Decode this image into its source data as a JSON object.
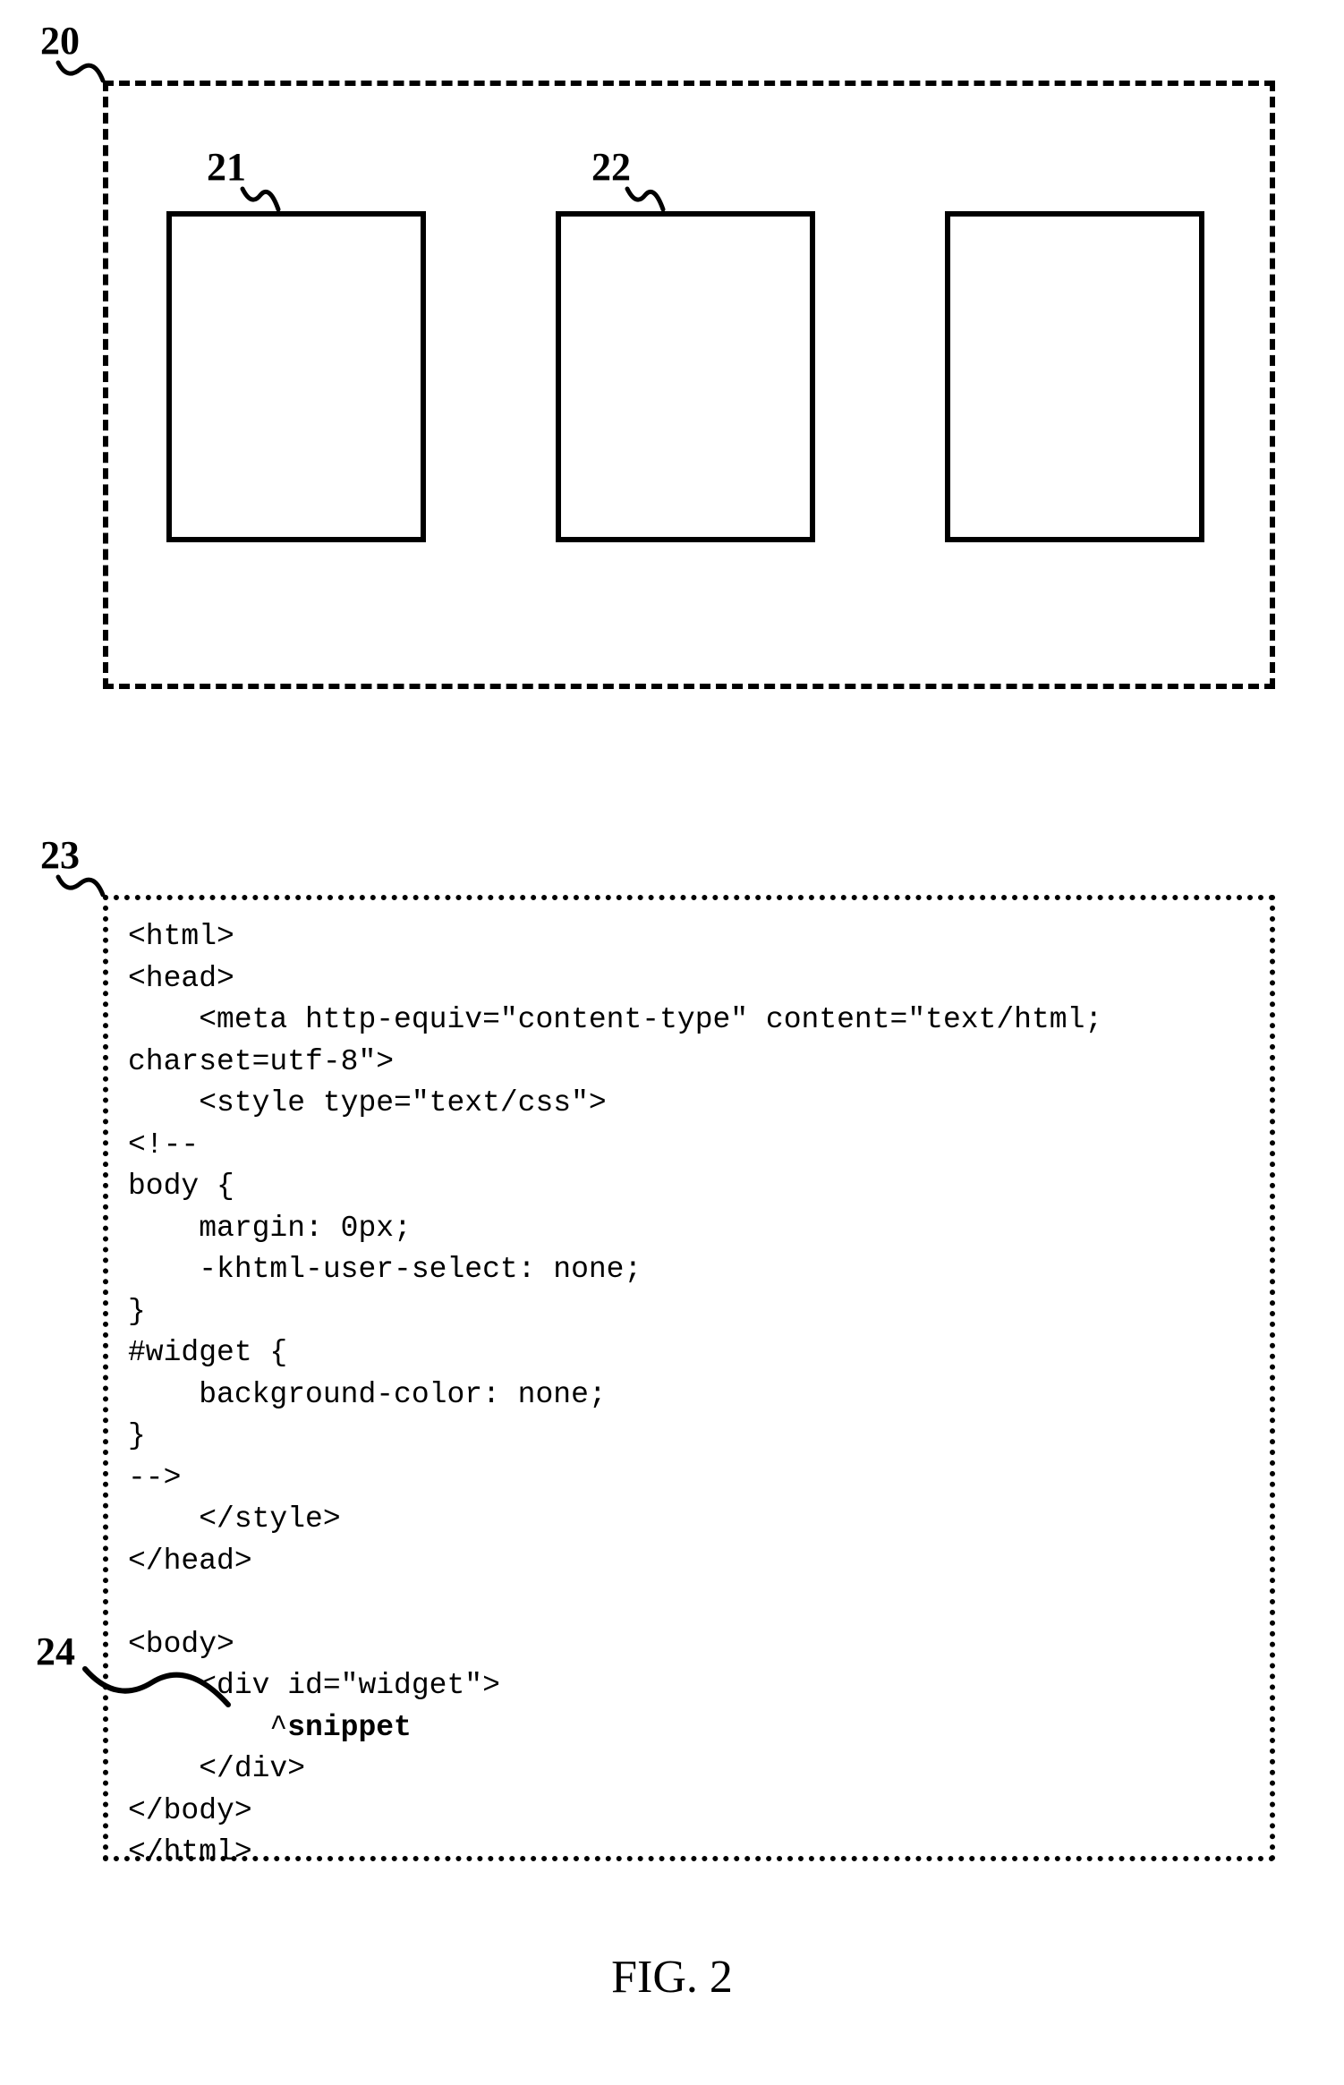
{
  "labels": {
    "l20": "20",
    "l21": "21",
    "l22": "22",
    "l23": "23",
    "l24": "24"
  },
  "code": {
    "line01": "<html>",
    "line02": "<head>",
    "line03": "    <meta http-equiv=\"content-type\" content=\"text/html;",
    "line04": "charset=utf-8\">",
    "line05": "    <style type=\"text/css\">",
    "line06": "<!--",
    "line07": "body {",
    "line08": "    margin: 0px;",
    "line09": "    -khtml-user-select: none;",
    "line10": "}",
    "line11": "#widget {",
    "line12": "    background-color: none;",
    "line13": "}",
    "line14": "-->",
    "line15": "    </style>",
    "line16": "</head>",
    "line17": "",
    "line18": "<body>",
    "line19": "    <div id=\"widget\">",
    "line20a": "        ^",
    "line20b": "snippet",
    "line21": "    </div>",
    "line22": "</body>",
    "line23": "</html>"
  },
  "caption": "FIG. 2"
}
